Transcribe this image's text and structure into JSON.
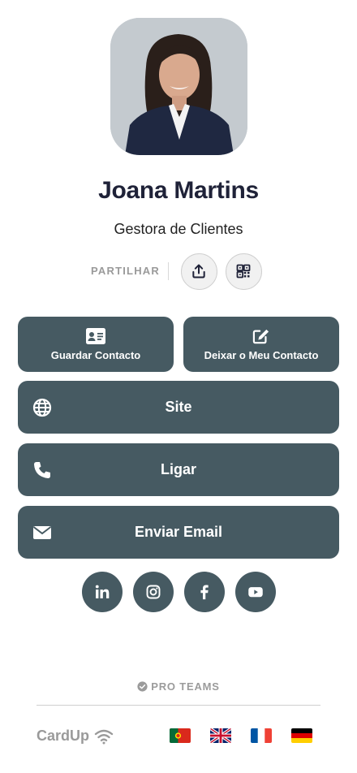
{
  "profile": {
    "name": "Joana Martins",
    "role": "Gestora de Clientes"
  },
  "share": {
    "label": "PARTILHAR",
    "upload_icon": "upload-icon",
    "qr_icon": "qr-code-icon"
  },
  "actions": {
    "save_contact": "Guardar Contacto",
    "leave_contact": "Deixar o Meu Contacto",
    "site": "Site",
    "call": "Ligar",
    "email": "Enviar Email"
  },
  "social": [
    "linkedin",
    "instagram",
    "facebook",
    "youtube"
  ],
  "footer": {
    "pro_label": "PRO TEAMS",
    "brand": "CardUp",
    "languages": [
      "Português",
      "English",
      "Français",
      "Deutsch"
    ]
  },
  "colors": {
    "button": "#465a62",
    "title": "#1f2238",
    "muted": "#9a9a9a"
  }
}
